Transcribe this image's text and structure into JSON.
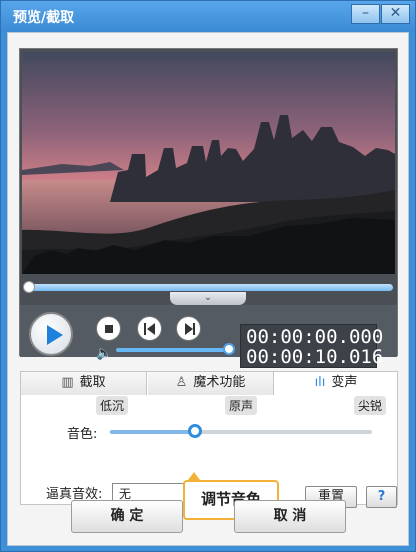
{
  "window": {
    "title": "预览/截取"
  },
  "window_controls": {
    "minimize": "–",
    "close": "✕"
  },
  "player": {
    "time_current": "00:00:00.000",
    "time_total": "00:00:10.016",
    "progress_percent": 0,
    "volume_percent": 100
  },
  "tabs": [
    {
      "label": "截取",
      "icon": "clip-icon"
    },
    {
      "label": "魔术功能",
      "icon": "magic-hat-icon"
    },
    {
      "label": "变声",
      "icon": "soundwave-icon"
    }
  ],
  "voice": {
    "tone_label": "音色:",
    "levels": [
      "低沉",
      "原声",
      "尖锐"
    ],
    "tone_position_percent": 33,
    "effect_label": "逼真音效:",
    "effect_value": "无",
    "reset_label": "重置",
    "help_label": "?"
  },
  "tooltip": {
    "text": "调节音色"
  },
  "buttons": {
    "ok": "确 定",
    "cancel": "取 消"
  }
}
